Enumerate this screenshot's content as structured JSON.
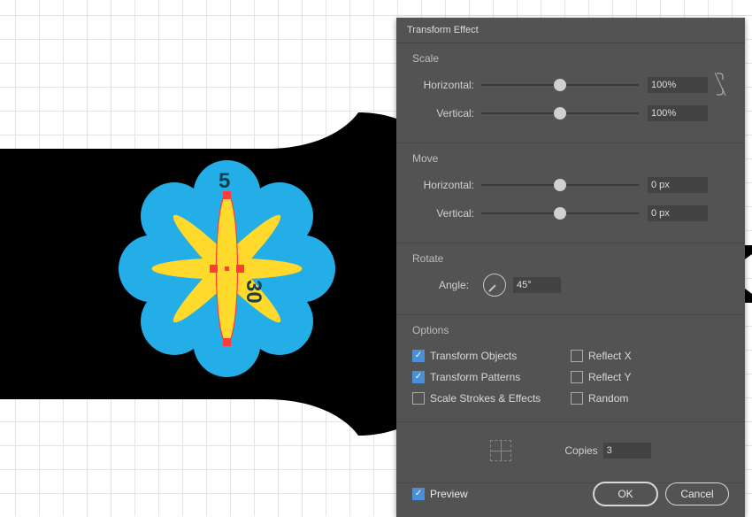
{
  "dialog": {
    "title": "Transform Effect",
    "sections": {
      "scale": {
        "heading": "Scale",
        "horizontal_label": "Horizontal:",
        "horizontal_value": "100%",
        "vertical_label": "Vertical:",
        "vertical_value": "100%"
      },
      "move": {
        "heading": "Move",
        "horizontal_label": "Horizontal:",
        "horizontal_value": "0 px",
        "vertical_label": "Vertical:",
        "vertical_value": "0 px"
      },
      "rotate": {
        "heading": "Rotate",
        "angle_label": "Angle:",
        "angle_value": "45°"
      },
      "options": {
        "heading": "Options",
        "transform_objects": "Transform Objects",
        "transform_patterns": "Transform Patterns",
        "scale_strokes": "Scale Strokes & Effects",
        "reflect_x": "Reflect X",
        "reflect_y": "Reflect Y",
        "random": "Random",
        "checked": {
          "transform_objects": true,
          "transform_patterns": true,
          "scale_strokes": false,
          "reflect_x": false,
          "reflect_y": false,
          "random": false
        }
      },
      "copies": {
        "label": "Copies",
        "value": "3"
      }
    },
    "footer": {
      "preview_label": "Preview",
      "preview_checked": true,
      "ok": "OK",
      "cancel": "Cancel"
    }
  },
  "canvas": {
    "annotations": {
      "top_value": "5",
      "right_value": "30"
    }
  }
}
